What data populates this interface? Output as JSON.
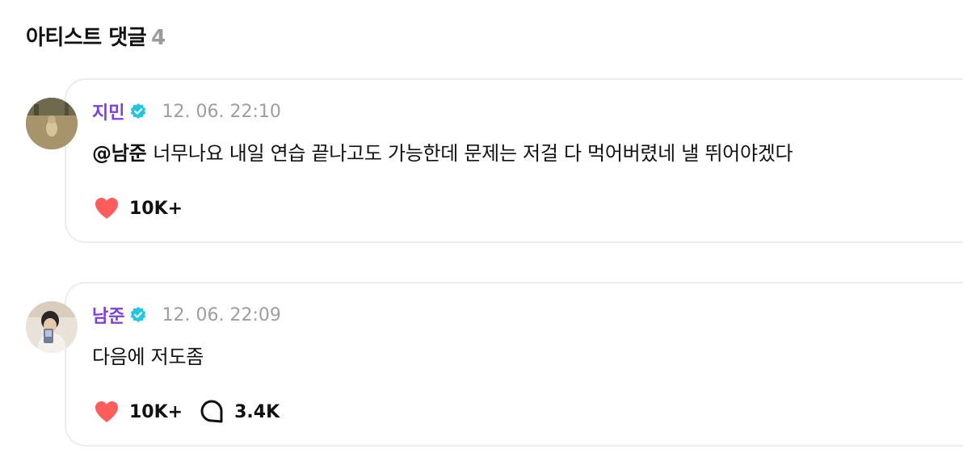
{
  "section": {
    "title": "아티스트 댓글",
    "count": "4"
  },
  "comments": [
    {
      "author": "지민",
      "verified_icon": "verified-check-icon",
      "timestamp": "12. 06. 22:10",
      "mention": "@남준",
      "text": "너무나요 내일 연습 끝나고도 가능한데 문제는 저걸 다 먹어버렸네 낼 뛰어야겠다",
      "likes": "10K+",
      "replies": null
    },
    {
      "author": "남준",
      "verified_icon": "verified-check-icon",
      "timestamp": "12. 06. 22:09",
      "mention": "",
      "text": "다음에 저도좀",
      "likes": "10K+",
      "replies": "3.4K"
    }
  ],
  "colors": {
    "author": "#7b3fe4",
    "verified": "#1fc7e0",
    "like": "#ff5c5c",
    "timestamp": "#9e9e9e",
    "border": "#ececec"
  },
  "icons": {
    "like": "heart-icon",
    "reply": "speech-bubble-icon"
  }
}
